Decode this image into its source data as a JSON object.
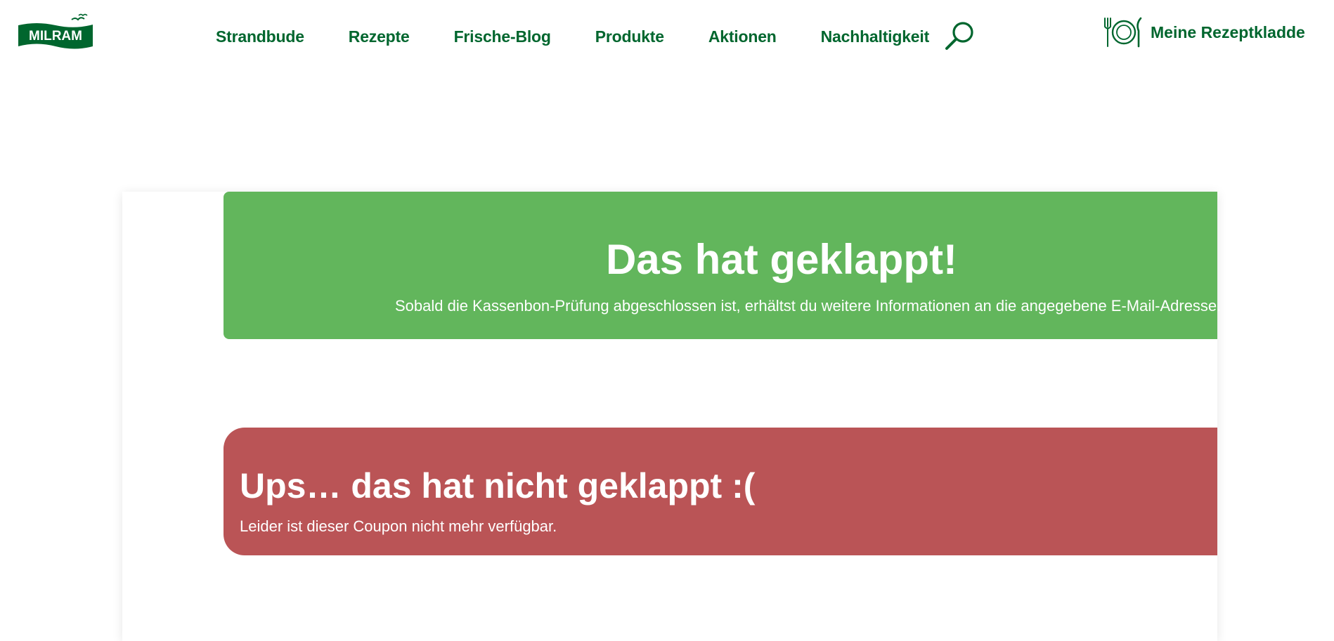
{
  "brand": {
    "logo_text": "MILRAM",
    "color": "#00662e"
  },
  "nav": {
    "items": [
      {
        "label": "Strandbude"
      },
      {
        "label": "Rezepte"
      },
      {
        "label": "Frische-Blog"
      },
      {
        "label": "Produkte"
      },
      {
        "label": "Aktionen"
      },
      {
        "label": "Nachhaltigkeit"
      }
    ],
    "search_icon": "search-icon",
    "recipe_link_label": "Meine Rezeptkladde",
    "recipe_icon": "plate-cutlery-icon"
  },
  "success": {
    "title": "Das hat geklappt!",
    "text": "Sobald die Kassenbon-Prüfung abgeschlossen ist, erhältst du weitere Informationen an die angegebene E-Mail-Adresse.",
    "color": "#62b65c"
  },
  "error": {
    "title": "Ups… das hat nicht geklappt :(",
    "text": "Leider ist dieser Coupon nicht mehr verfügbar.",
    "color": "#ba5456"
  }
}
